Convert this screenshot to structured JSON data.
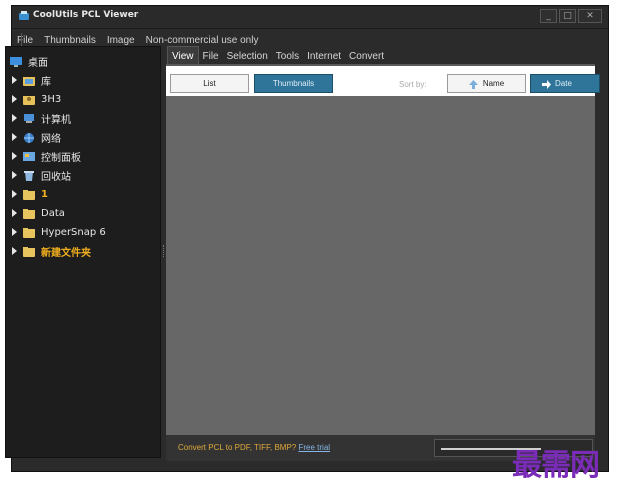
{
  "window": {
    "title": "CoolUtils PCL Viewer"
  },
  "menu": [
    "File",
    "Thumbnails",
    "Image",
    "Non-commercial use only"
  ],
  "tree": {
    "items": [
      {
        "label": "桌面",
        "icon": "desktop-icon",
        "highlight": false,
        "has_arrow": false
      },
      {
        "label": "库",
        "icon": "library-folder-icon",
        "highlight": false,
        "has_arrow": true
      },
      {
        "label": "3H3",
        "icon": "user-folder-icon",
        "highlight": false,
        "has_arrow": true
      },
      {
        "label": "计算机",
        "icon": "computer-icon",
        "highlight": false,
        "has_arrow": true
      },
      {
        "label": "网络",
        "icon": "network-icon",
        "highlight": false,
        "has_arrow": true
      },
      {
        "label": "控制面板",
        "icon": "control-panel-icon",
        "highlight": false,
        "has_arrow": true
      },
      {
        "label": "回收站",
        "icon": "recycle-bin-icon",
        "highlight": false,
        "has_arrow": true
      },
      {
        "label": "1",
        "icon": "folder-icon",
        "highlight": true,
        "has_arrow": true
      },
      {
        "label": "Data",
        "icon": "folder-icon",
        "highlight": false,
        "has_arrow": true
      },
      {
        "label": "HyperSnap 6",
        "icon": "folder-icon",
        "highlight": false,
        "has_arrow": true
      },
      {
        "label": "新建文件夹",
        "icon": "folder-icon",
        "highlight": true,
        "has_arrow": true
      }
    ]
  },
  "tabs": [
    "View",
    "File",
    "Selection",
    "Tools",
    "Internet",
    "Convert"
  ],
  "active_tab": "View",
  "toolbar": {
    "list_label": "List",
    "thumbnails_label": "Thumbnails",
    "sort_by_label": "Sort by:",
    "name_label": "Name",
    "date_label": "Date"
  },
  "status": {
    "text": "Convert PCL to PDF, TIFF, BMP?",
    "link": "Free trial"
  },
  "watermark": "最需网",
  "colors": {
    "accent": "#2f7499",
    "highlight_text": "#f2b01e",
    "status_text": "#e0a93a",
    "content_bg": "#676767"
  }
}
